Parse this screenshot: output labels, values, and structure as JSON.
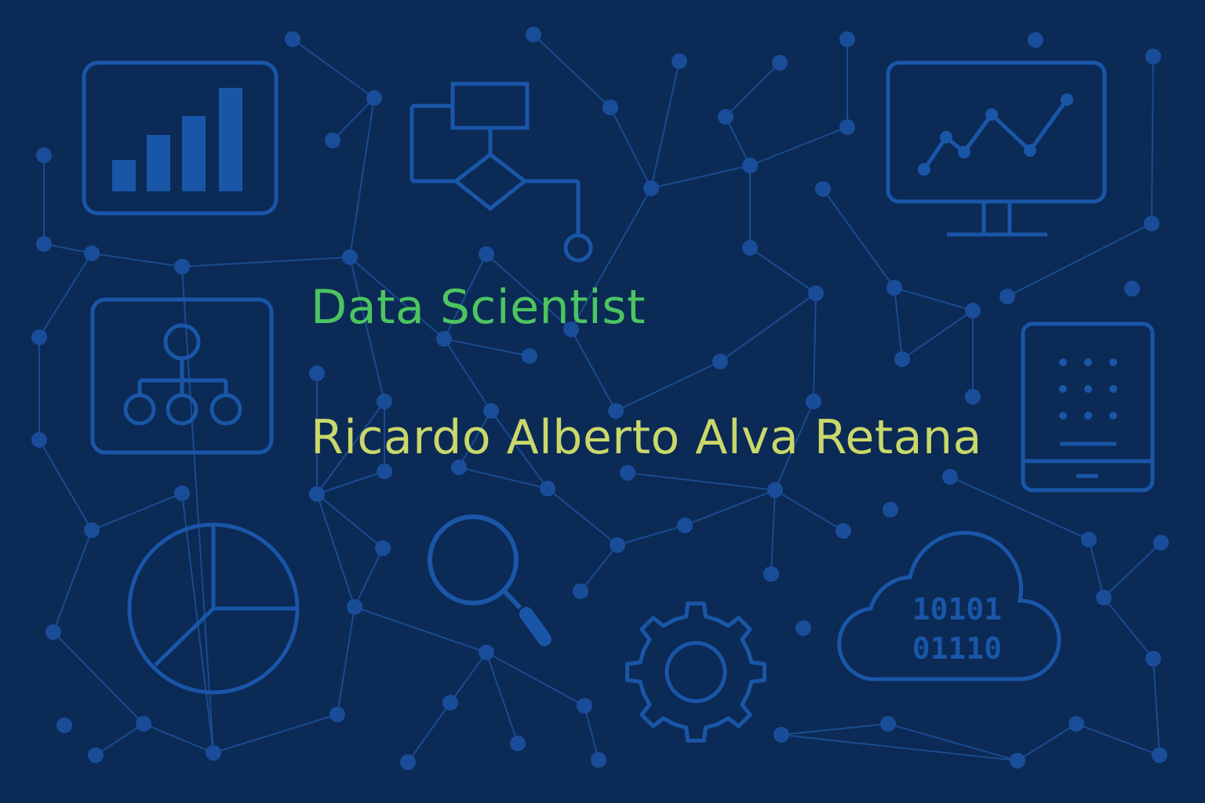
{
  "banner": {
    "role": "Data Scientist",
    "name": "Ricardo Alberto Alva Retana"
  },
  "cloud": {
    "binary_line_1": "10101",
    "binary_line_2": "01110"
  },
  "colors": {
    "background": "#0b2a55",
    "icon_stroke": "#1a56a8",
    "line": "#1a4b90",
    "node": "#1a4d99",
    "role_text": "#4cc561",
    "name_text": "#c9d86a"
  },
  "icons": [
    "bar-chart-icon",
    "flowchart-icon",
    "monitor-line-chart-icon",
    "org-chart-icon",
    "tablet-icon",
    "pie-chart-icon",
    "magnifier-icon",
    "gear-icon",
    "cloud-binary-icon"
  ]
}
